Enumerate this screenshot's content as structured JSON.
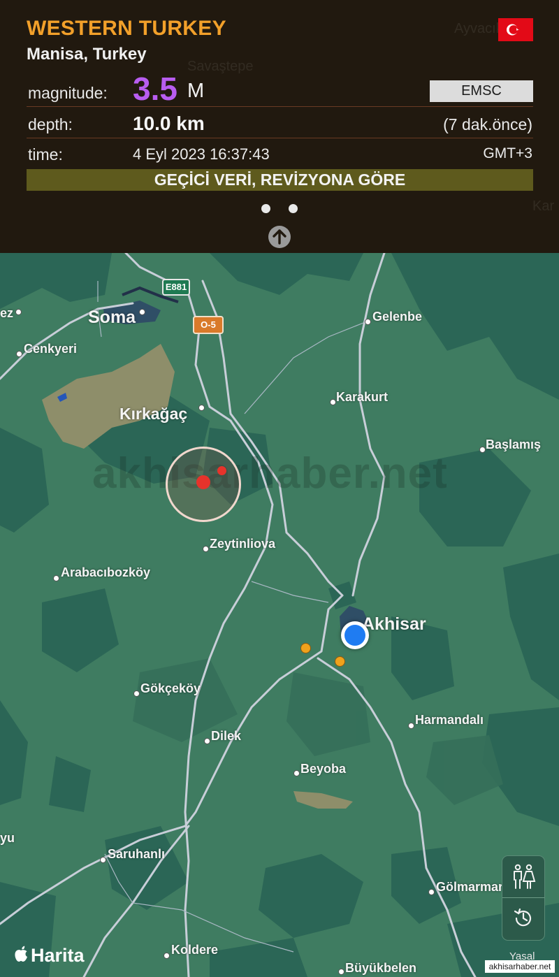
{
  "header": {
    "region": "WESTERN TURKEY",
    "place": "Manisa, Turkey",
    "magnitude_label": "magnitude:",
    "magnitude_value": "3.5",
    "magnitude_unit": "M",
    "source": "EMSC",
    "depth_label": "depth:",
    "depth_value": "10.0 km",
    "ago": "(7 dak.önce)",
    "time_label": "time:",
    "time_value": "4 Eyl 2023 16:37:43",
    "timezone": "GMT+3",
    "banner": "GEÇİCİ VERİ, REVİZYONA GÖRE",
    "background_labels": [
      "Ayvacık",
      "Savaştepe",
      "Kar"
    ],
    "colors": {
      "region": "#f2a02a",
      "magnitude": "#b85df0",
      "banner": "#5e5a1d"
    }
  },
  "map": {
    "watermark": "akhisarhaber.net",
    "road_badges": {
      "e881": "E881",
      "o5": "O-5"
    },
    "towns": {
      "ez": "ez",
      "soma": "Soma",
      "cenkyeri": "Cenkyeri",
      "gelenbe": "Gelenbe",
      "karakurt": "Karakurt",
      "kirkagac": "Kırkağaç",
      "baslamis": "Başlamış",
      "zeytinliova": "Zeytinliova",
      "arabacibozkoy": "Arabacıbozköy",
      "akhisar": "Akhisar",
      "gokcekoy": "Gökçeköy",
      "harmandali": "Harmandalı",
      "dilek": "Dilek",
      "beyoba": "Beyoba",
      "yu": "yu",
      "saruhanli": "Saruhanlı",
      "golmarmara": "Gölmarmara",
      "koldere": "Koldere",
      "buyukbelen": "Büyükbelen"
    },
    "brand": "Harita",
    "legal": "Yasal",
    "site_tag": "akhisarhaber.net",
    "controls": {
      "people": "people-icon",
      "history": "history-icon"
    }
  }
}
